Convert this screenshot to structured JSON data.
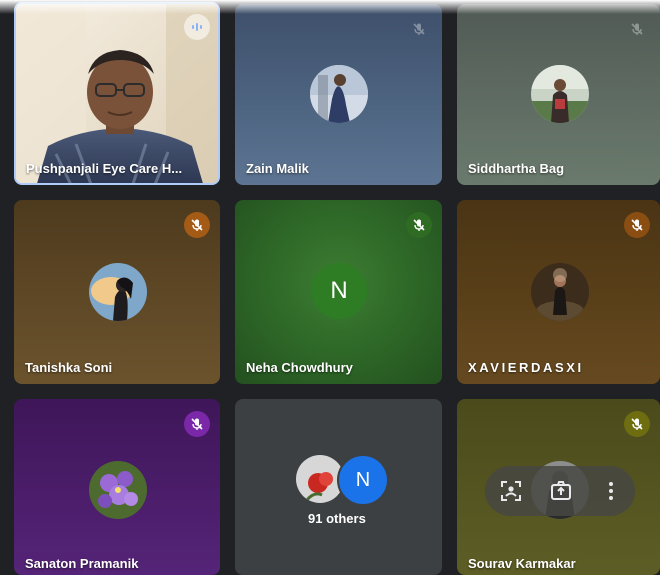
{
  "tiles": [
    {
      "name": "Pushpanjali Eye Care H...",
      "state": "speaking"
    },
    {
      "name": "Zain Malik",
      "mic": "muted"
    },
    {
      "name": "Siddhartha Bag",
      "mic": "muted"
    },
    {
      "name": "Tanishka Soni",
      "mic": "muted"
    },
    {
      "name": "Neha Chowdhury",
      "mic": "muted",
      "avatar_letter": "N"
    },
    {
      "name": "XAVIERDASXI",
      "mic": "muted"
    },
    {
      "name": "Sanaton Pramanik",
      "mic": "muted"
    },
    {
      "others_label": "91 others",
      "avatar_letter": "N"
    },
    {
      "name": "Sourav Karmakar",
      "mic": "muted"
    }
  ],
  "tile_controls": {
    "icons": [
      "frame-person-icon",
      "pin-icon",
      "more-options-icon"
    ]
  },
  "colors": {
    "background": "#202124",
    "mic_orange": "#a35b16",
    "mic_green": "#2f6b23",
    "mic_purple": "#7a27a8",
    "mic_olive": "#6e6d10",
    "letter_avatar_green": "#2e7d24",
    "letter_avatar_blue": "#1a73e8",
    "active_outline": "#aecbfa"
  }
}
